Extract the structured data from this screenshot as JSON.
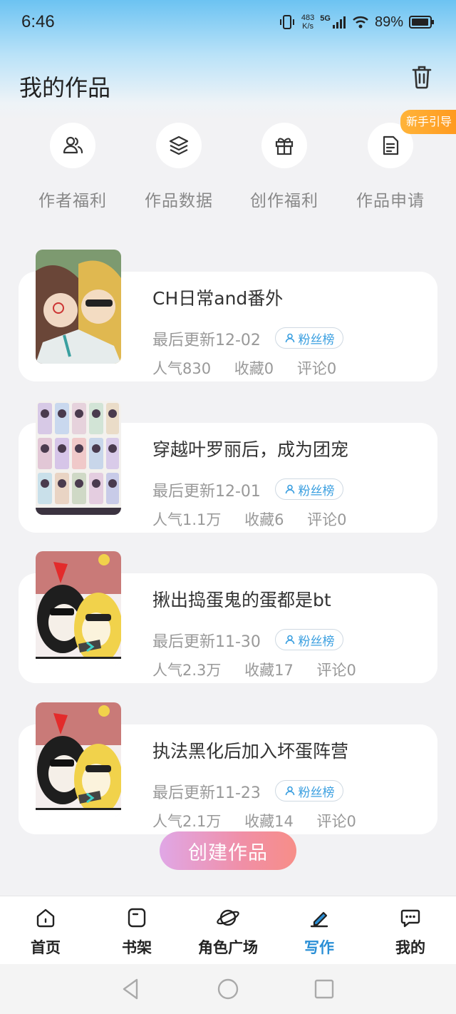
{
  "status_bar": {
    "time": "6:46",
    "net_speed_value": "483",
    "net_speed_unit": "K/s",
    "network": "5G",
    "battery": "89%"
  },
  "header": {
    "title": "我的作品",
    "trash_icon": "trash-icon"
  },
  "quick_actions": [
    {
      "label": "作者福利",
      "icon": "author-icon"
    },
    {
      "label": "作品数据",
      "icon": "layers-icon"
    },
    {
      "label": "创作福利",
      "icon": "gift-icon"
    },
    {
      "label": "作品申请",
      "icon": "document-icon"
    }
  ],
  "guide_badge": "新手引导",
  "works": [
    {
      "title": "CH日常and番外",
      "update": "最后更新12-02",
      "fans_label": "粉丝榜",
      "popularity": "人气830",
      "favorites": "收藏0",
      "comments": "评论0"
    },
    {
      "title": "穿越叶罗丽后，成为团宠",
      "update": "最后更新12-01",
      "fans_label": "粉丝榜",
      "popularity": "人气1.1万",
      "favorites": "收藏6",
      "comments": "评论0"
    },
    {
      "title": "揪出捣蛋鬼的蛋都是bt",
      "update": "最后更新11-30",
      "fans_label": "粉丝榜",
      "popularity": "人气2.3万",
      "favorites": "收藏17",
      "comments": "评论0"
    },
    {
      "title": "执法黑化后加入坏蛋阵营",
      "update": "最后更新11-23",
      "fans_label": "粉丝榜",
      "popularity": "人气2.1万",
      "favorites": "收藏14",
      "comments": "评论0"
    }
  ],
  "create_button": "创建作品",
  "bottom_nav": [
    {
      "label": "首页",
      "icon": "home-icon",
      "active": false
    },
    {
      "label": "书架",
      "icon": "bookshelf-icon",
      "active": false
    },
    {
      "label": "角色广场",
      "icon": "planet-icon",
      "active": false
    },
    {
      "label": "写作",
      "icon": "pen-icon",
      "active": true
    },
    {
      "label": "我的",
      "icon": "chat-icon",
      "active": false
    }
  ],
  "colors": {
    "accent": "#2a8fd6",
    "guide_badge": "#ffa52a",
    "create_gradient_start": "#e0a7e6",
    "create_gradient_end": "#f78e88"
  }
}
